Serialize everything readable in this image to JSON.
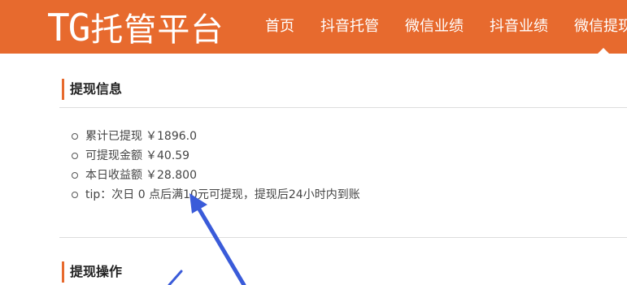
{
  "header": {
    "logo_tg": "TG",
    "logo_cn": "托管平台",
    "nav": [
      {
        "label": "首页"
      },
      {
        "label": "抖音托管"
      },
      {
        "label": "微信业绩"
      },
      {
        "label": "抖音业绩"
      },
      {
        "label": "微信提现"
      }
    ]
  },
  "info_section": {
    "title": "提现信息",
    "items": [
      {
        "label": "累计已提现",
        "value": "￥1896.0"
      },
      {
        "label": "可提现金额",
        "value": "￥40.59"
      },
      {
        "label": "本日收益额",
        "value": "￥28.800"
      },
      {
        "label": "tip：次日 0 点后满10元可提现，提现后24小时内到账",
        "value": ""
      }
    ]
  },
  "action_section": {
    "title": "提现操作"
  },
  "colors": {
    "brand": "#e76a2e",
    "annotation_arrow": "#3a5bd9"
  }
}
